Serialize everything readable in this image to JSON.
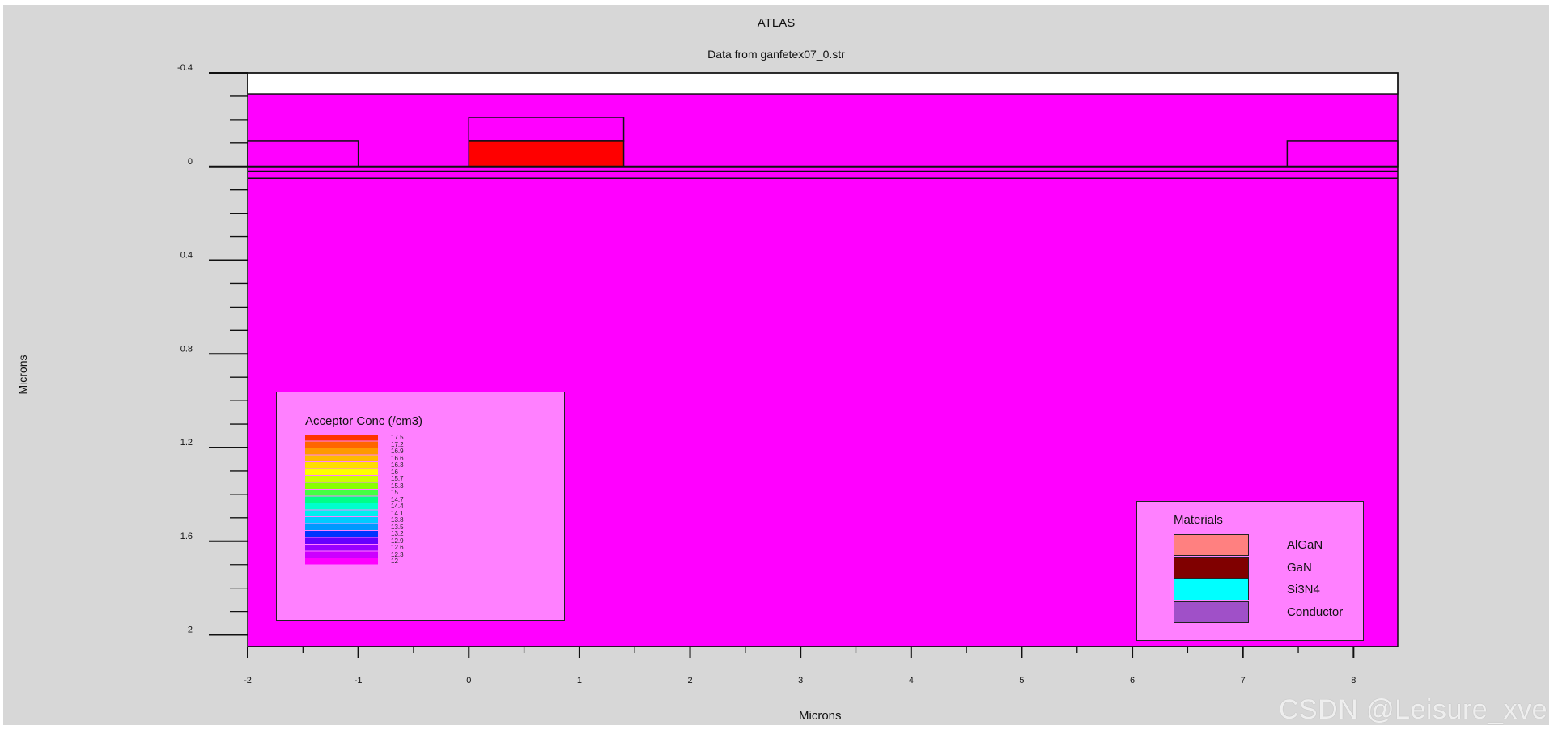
{
  "chart_data": {
    "type": "structure",
    "title": "ATLAS",
    "subtitle": "Data from ganfetex07_0.str",
    "xlabel": "Microns",
    "ylabel": "Microns",
    "xlim": [
      -2,
      8.4
    ],
    "ylim": [
      -0.4,
      2.05
    ],
    "y_inverted": true,
    "x_ticks": [
      "-2",
      "-1",
      "0",
      "1",
      "2",
      "3",
      "4",
      "5",
      "6",
      "7",
      "8"
    ],
    "x_tick_values": [
      -2,
      -1,
      0,
      1,
      2,
      3,
      4,
      5,
      6,
      7,
      8
    ],
    "y_ticks": [
      "-0.4",
      "0",
      "0.4",
      "0.8",
      "1.2",
      "1.6",
      "2"
    ],
    "y_tick_values": [
      -0.4,
      0,
      0.4,
      0.8,
      1.2,
      1.6,
      2
    ],
    "background_color": "#ff00ff",
    "regions": [
      {
        "name": "air-top",
        "x": [
          -2,
          8.4
        ],
        "y": [
          -0.4,
          -0.31
        ],
        "color": "#ffffff"
      },
      {
        "name": "source-electrode",
        "x": [
          -2,
          -1
        ],
        "y": [
          -0.11,
          0
        ],
        "color": "#ff00ff"
      },
      {
        "name": "gate-cap",
        "x": [
          0,
          1.4
        ],
        "y": [
          -0.21,
          -0.11
        ],
        "color": "#ff00ff"
      },
      {
        "name": "gate-electrode",
        "x": [
          0,
          1.4
        ],
        "y": [
          -0.11,
          0
        ],
        "color": "#ff0000"
      },
      {
        "name": "drain-electrode",
        "x": [
          7.4,
          8.4
        ],
        "y": [
          -0.11,
          0
        ],
        "color": "#ff00ff"
      }
    ],
    "interfaces_y": [
      0.02,
      0.05
    ],
    "acceptor_legend": {
      "title": "Acceptor Conc (/cm3)",
      "levels": [
        "17.5",
        "17.2",
        "16.9",
        "16.6",
        "16.3",
        "16",
        "15.7",
        "15.3",
        "15",
        "14.7",
        "14.4",
        "14.1",
        "13.8",
        "13.5",
        "13.2",
        "12.9",
        "12.6",
        "12.3",
        "12"
      ],
      "colors": [
        "#ff3300",
        "#ff6600",
        "#ff9900",
        "#ffbb00",
        "#ffdd00",
        "#ffff00",
        "#ccff00",
        "#88ff00",
        "#44ff44",
        "#00ff88",
        "#00ffcc",
        "#00eeee",
        "#00ccff",
        "#0099ff",
        "#0033ff",
        "#6600ff",
        "#9900ff",
        "#cc00ff",
        "#ff00ff"
      ]
    },
    "materials_legend": {
      "title": "Materials",
      "items": [
        {
          "label": "AlGaN",
          "color": "#ff8080"
        },
        {
          "label": "GaN",
          "color": "#800000"
        },
        {
          "label": "Si3N4",
          "color": "#00ffff"
        },
        {
          "label": "Conductor",
          "color": "#a050c8"
        }
      ]
    }
  },
  "watermark": "CSDN @Leisure_xve"
}
